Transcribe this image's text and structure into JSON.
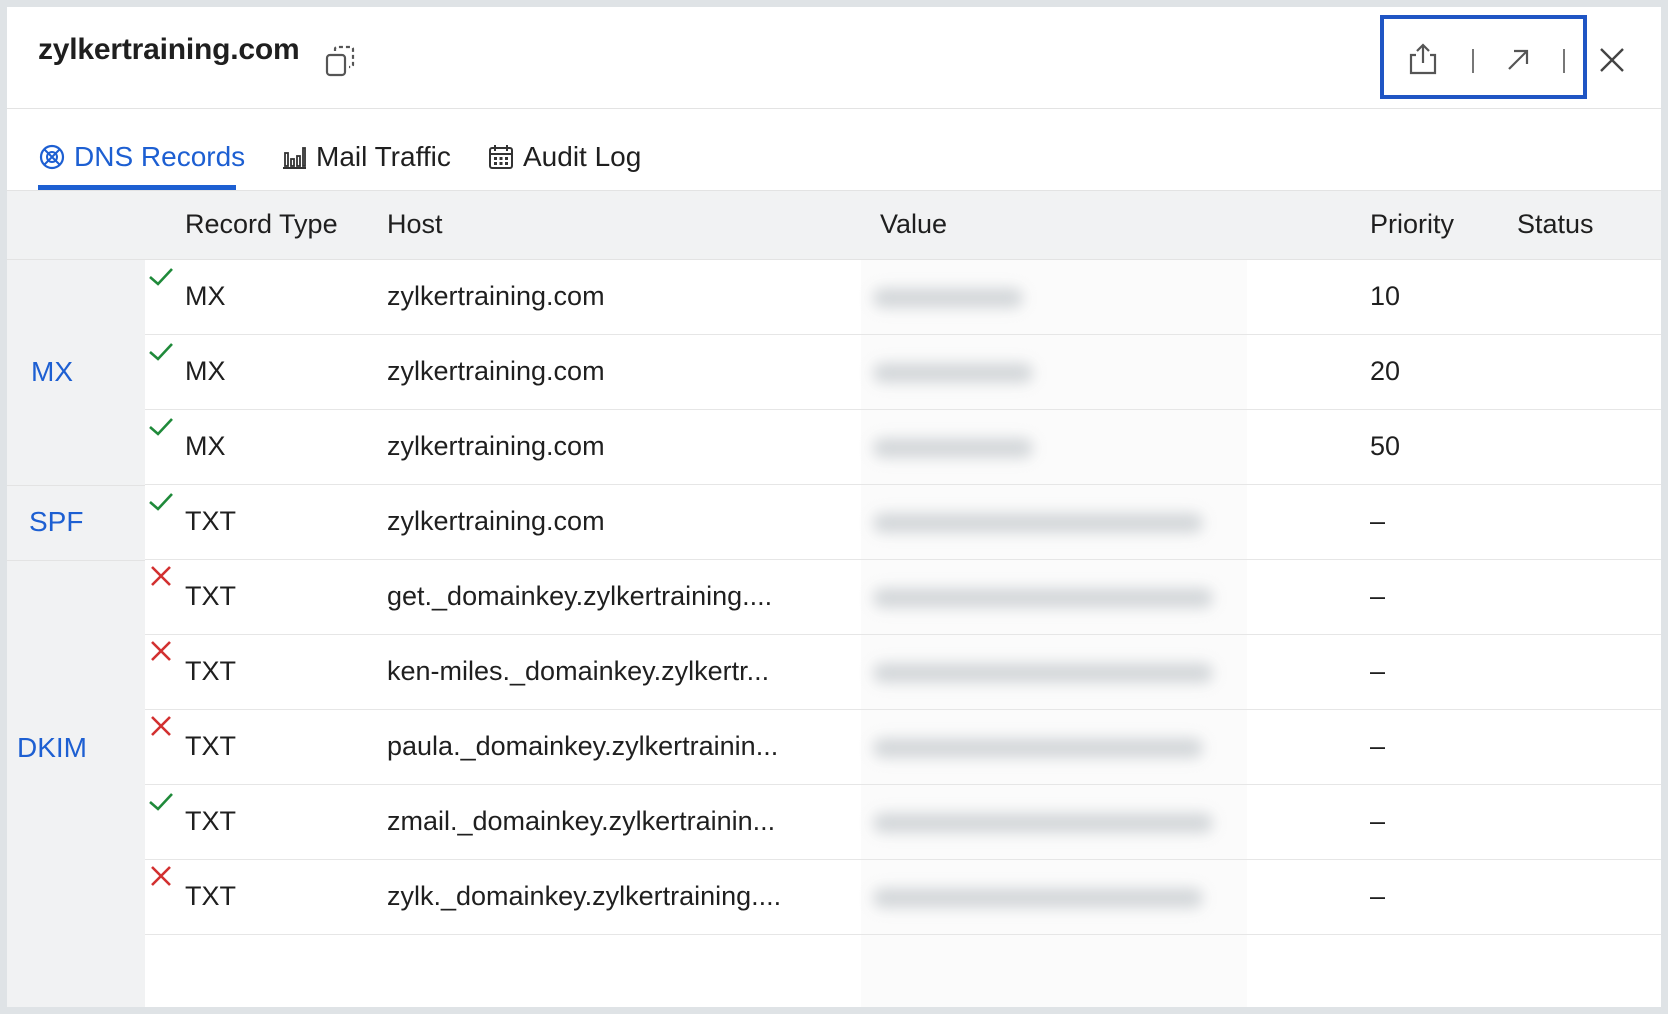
{
  "header": {
    "title": "zylkertraining.com",
    "icons": [
      "copy-icon",
      "export-icon",
      "open-external-icon",
      "close-icon"
    ]
  },
  "tabs": [
    {
      "label": "DNS Records",
      "icon": "globe-icon",
      "active": true
    },
    {
      "label": "Mail Traffic",
      "icon": "bar-chart-icon",
      "active": false
    },
    {
      "label": "Audit Log",
      "icon": "calendar-icon",
      "active": false
    }
  ],
  "table": {
    "columns": [
      "Record Type",
      "Host",
      "Value",
      "Priority",
      "Status"
    ],
    "groups": [
      "MX",
      "SPF",
      "DKIM"
    ],
    "rows": [
      {
        "type": "MX",
        "host": "zylkertraining.com",
        "priority": "10",
        "status": "check-icon"
      },
      {
        "type": "MX",
        "host": "zylkertraining.com",
        "priority": "20",
        "status": "check-icon"
      },
      {
        "type": "MX",
        "host": "zylkertraining.com",
        "priority": "50",
        "status": "check-icon"
      },
      {
        "type": "TXT",
        "host": "zylkertraining.com",
        "priority": "–",
        "status": "check-icon"
      },
      {
        "type": "TXT",
        "host": "get._domainkey.zylkertraining....",
        "priority": "–",
        "status": "cross-icon"
      },
      {
        "type": "TXT",
        "host": "ken-miles._domainkey.zylkertr...",
        "priority": "–",
        "status": "cross-icon"
      },
      {
        "type": "TXT",
        "host": "paula._domainkey.zylkertrainin...",
        "priority": "–",
        "status": "cross-icon"
      },
      {
        "type": "TXT",
        "host": "zmail._domainkey.zylkertrainin...",
        "priority": "–",
        "status": "check-icon"
      },
      {
        "type": "TXT",
        "host": "zylk._domainkey.zylkertraining....",
        "priority": "–",
        "status": "cross-icon"
      }
    ]
  },
  "colors": {
    "accent": "#1d5fd2",
    "success": "#1f8a3a",
    "error": "#d23030",
    "highlight": "#1f55c4"
  }
}
